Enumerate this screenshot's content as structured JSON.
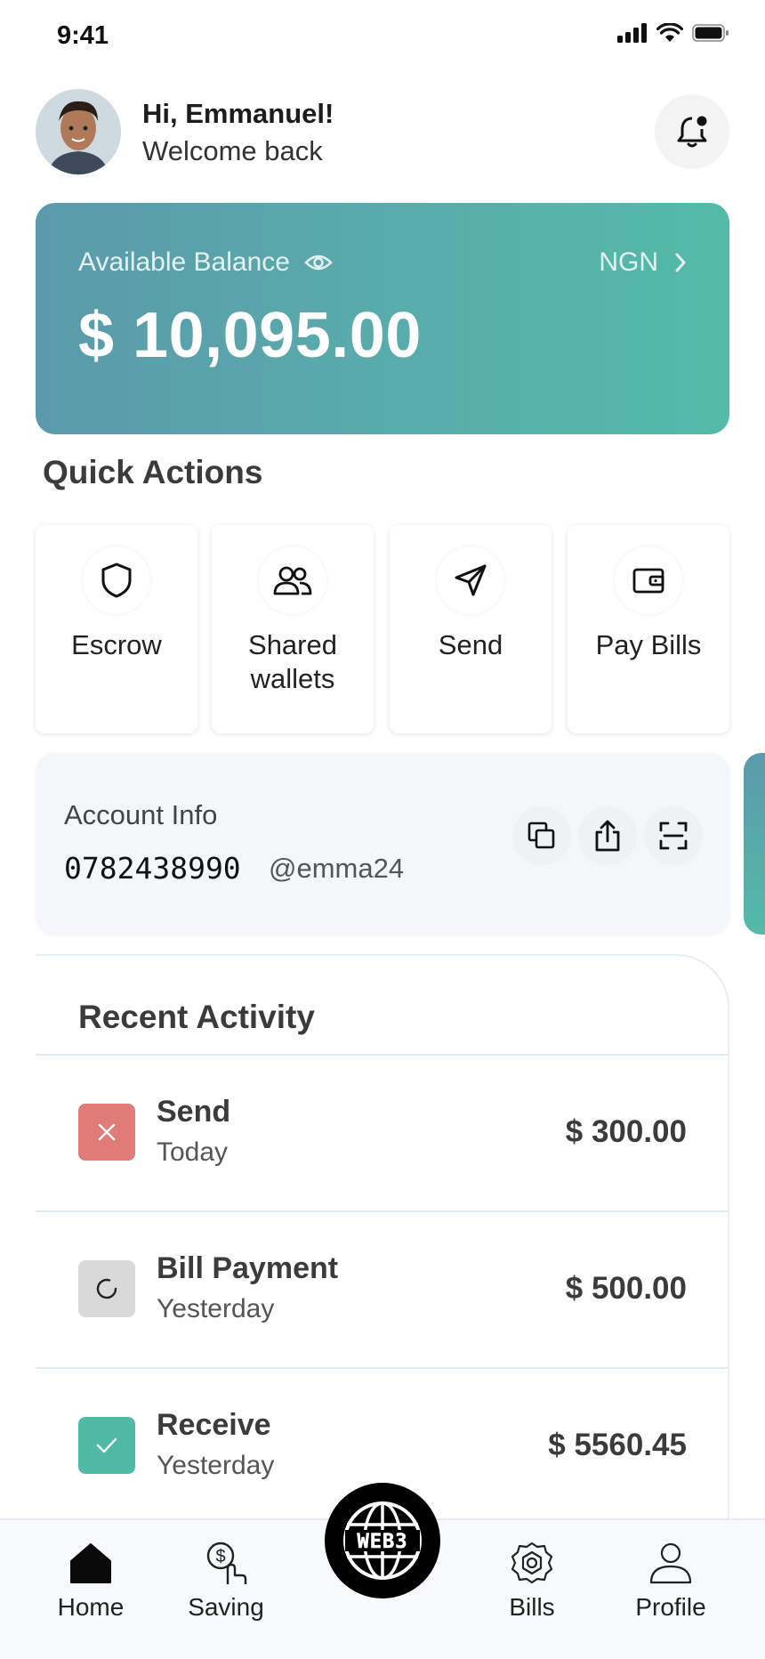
{
  "status_bar": {
    "time": "9:41"
  },
  "header": {
    "greeting": "Hi, Emmanuel!",
    "subtitle": "Welcome back"
  },
  "balance": {
    "label": "Available Balance",
    "currency": "NGN",
    "amount": "$ 10,095.00"
  },
  "quick_actions": {
    "title": "Quick Actions",
    "items": [
      {
        "label": "Escrow",
        "icon": "shield-icon"
      },
      {
        "label": "Shared wallets",
        "icon": "users-icon"
      },
      {
        "label": "Send",
        "icon": "paper-plane-icon"
      },
      {
        "label": "Pay Bills",
        "icon": "wallet-icon"
      }
    ]
  },
  "account": {
    "label": "Account Info",
    "number": "0782438990",
    "handle": "@emma24"
  },
  "activity": {
    "title": "Recent Activity",
    "items": [
      {
        "name": "Send",
        "date": "Today",
        "amount": "$ 300.00",
        "status": "failed",
        "color": "#e07b78"
      },
      {
        "name": "Bill Payment",
        "date": "Yesterday",
        "amount": "$ 500.00",
        "status": "pending",
        "color": "#d9d9d9"
      },
      {
        "name": "Receive",
        "date": "Yesterday",
        "amount": "$ 5560.45",
        "status": "success",
        "color": "#4fb9a5"
      }
    ]
  },
  "nav": {
    "home": "Home",
    "saving": "Saving",
    "center": "WEB3",
    "bills": "Bills",
    "profile": "Profile"
  },
  "colors": {
    "accent_start": "#5b9aab",
    "accent_end": "#53bba8"
  }
}
